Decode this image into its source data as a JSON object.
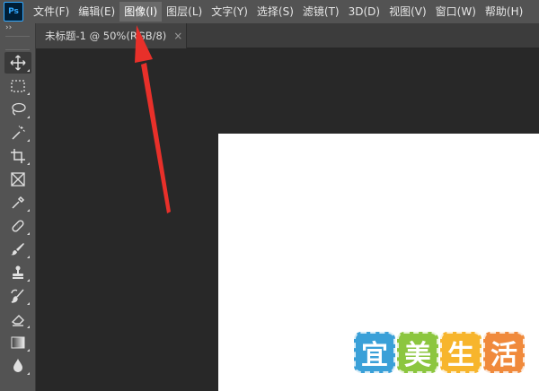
{
  "app": {
    "logo": "Ps"
  },
  "menu": [
    {
      "label": "文件(F)",
      "active": false
    },
    {
      "label": "编辑(E)",
      "active": false
    },
    {
      "label": "图像(I)",
      "active": true
    },
    {
      "label": "图层(L)",
      "active": false
    },
    {
      "label": "文字(Y)",
      "active": false
    },
    {
      "label": "选择(S)",
      "active": false
    },
    {
      "label": "滤镜(T)",
      "active": false
    },
    {
      "label": "3D(D)",
      "active": false
    },
    {
      "label": "视图(V)",
      "active": false
    },
    {
      "label": "窗口(W)",
      "active": false
    },
    {
      "label": "帮助(H)",
      "active": false
    }
  ],
  "document_tab": {
    "title": "未标题-1 @ 50%(RGB/8)",
    "close_glyph": "×"
  },
  "toolbar": {
    "collapse_glyph": "››",
    "tools": [
      "move-tool",
      "marquee-tool",
      "lasso-tool",
      "magic-wand-tool",
      "crop-tool",
      "frame-tool",
      "eyedropper-tool",
      "healing-brush-tool",
      "brush-tool",
      "clone-stamp-tool",
      "history-brush-tool",
      "eraser-tool",
      "gradient-tool",
      "blur-tool"
    ]
  },
  "watermark": {
    "chars": [
      "宜",
      "美",
      "生",
      "活"
    ],
    "colors": [
      "#3aa0d8",
      "#8cc63f",
      "#f7b52c",
      "#f08a3c"
    ]
  },
  "annotation_color": "#e8302a"
}
